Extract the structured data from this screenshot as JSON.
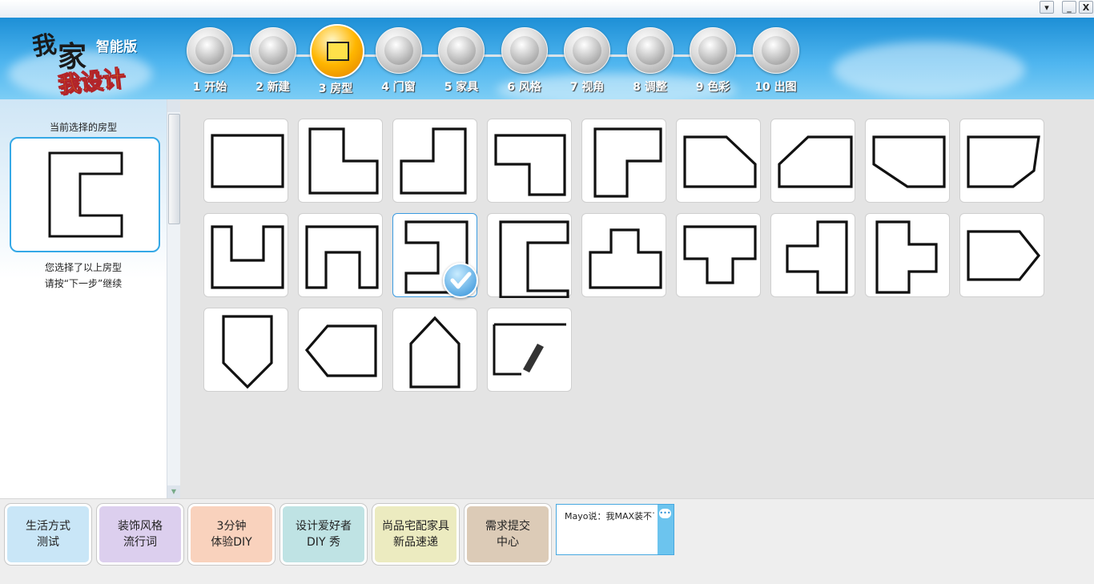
{
  "window": {
    "minimize_glyph": "_",
    "close_glyph": "X",
    "menu_glyph": "▾"
  },
  "logo": {
    "wo": "我",
    "jia": "家",
    "she": "我设计",
    "edition": "智能版"
  },
  "steps": [
    {
      "label": "1 开始",
      "icon": "arrow-right-icon"
    },
    {
      "label": "2 新建",
      "icon": "document-icon"
    },
    {
      "label": "3 房型",
      "icon": "floorplan-icon"
    },
    {
      "label": "4 门窗",
      "icon": "window-icon"
    },
    {
      "label": "5 家具",
      "icon": "furniture-icon"
    },
    {
      "label": "6 风格",
      "icon": "style-icon"
    },
    {
      "label": "7 视角",
      "icon": "cube-icon"
    },
    {
      "label": "8 调整",
      "icon": "adjust-icon"
    },
    {
      "label": "9 色彩",
      "icon": "color-icon"
    },
    {
      "label": "10 出图",
      "icon": "camera-icon"
    }
  ],
  "active_step": 3,
  "sidebar": {
    "current_title": "当前选择的房型",
    "msg_line1": "您选择了以上房型",
    "msg_line2": "请按“下一步”继续"
  },
  "floorplans": [
    {
      "name": "rectangle"
    },
    {
      "name": "l-shape-top-right-cut"
    },
    {
      "name": "l-shape-top-left-cut"
    },
    {
      "name": "l-shape-bottom-left-cut"
    },
    {
      "name": "l-shape-bottom-right-cut"
    },
    {
      "name": "top-right-chamfer"
    },
    {
      "name": "top-left-chamfer"
    },
    {
      "name": "bottom-both-chamfer"
    },
    {
      "name": "bottom-left-chamfer"
    },
    {
      "name": "u-shape-open-top"
    },
    {
      "name": "u-shape-open-bottom"
    },
    {
      "name": "u-shape-open-left"
    },
    {
      "name": "u-shape-open-right"
    },
    {
      "name": "t-shape-up"
    },
    {
      "name": "t-shape-down"
    },
    {
      "name": "t-shape-left"
    },
    {
      "name": "t-shape-right"
    },
    {
      "name": "arrow-right"
    },
    {
      "name": "shield-down"
    },
    {
      "name": "arrow-left"
    },
    {
      "name": "house-up"
    },
    {
      "name": "custom-draw"
    }
  ],
  "selected_floorplan": 12,
  "bottom_buttons": [
    {
      "label": "生活方式\n测试",
      "color": "#c9e6f7"
    },
    {
      "label": "装饰风格\n流行词",
      "color": "#dccfee"
    },
    {
      "label": "3分钟\n体验DIY",
      "color": "#f9d2bd"
    },
    {
      "label": "设计爱好者\nDIY 秀",
      "color": "#bfe3e4"
    },
    {
      "label": "尚品宅配家具\n新品速递",
      "color": "#ecebc0"
    },
    {
      "label": "需求提交\n中心",
      "color": "#dccbb7"
    }
  ],
  "chat": {
    "message": "Mayo说：我MAX装不了"
  },
  "colors": {
    "accent_blue": "#35a8e6",
    "active_step": "#ffb600",
    "grid_bg": "#e4e4e4"
  }
}
